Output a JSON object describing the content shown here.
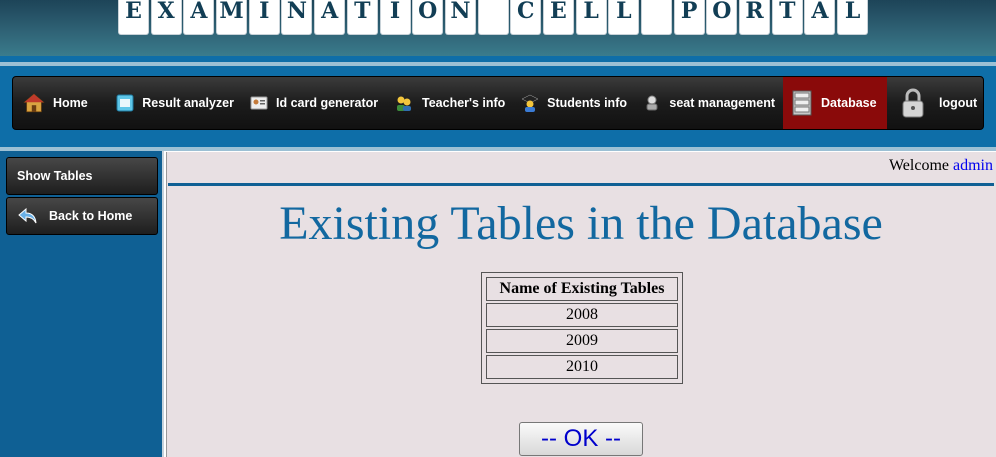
{
  "header": {
    "title_letters": [
      "E",
      "X",
      "A",
      "M",
      "I",
      "N",
      "A",
      "T",
      "I",
      "O",
      "N",
      " ",
      "C",
      "E",
      "L",
      "L",
      " ",
      "P",
      "O",
      "R",
      "T",
      "A",
      "L"
    ]
  },
  "nav": {
    "items": [
      {
        "label": "Home",
        "icon": "house-icon"
      },
      {
        "label": "Result analyzer",
        "icon": "chart-icon"
      },
      {
        "label": "Id card generator",
        "icon": "id-card-icon"
      },
      {
        "label": "Teacher's info",
        "icon": "group-icon"
      },
      {
        "label": "Students info",
        "icon": "student-icon"
      },
      {
        "label": "seat management",
        "icon": "seat-icon"
      },
      {
        "label": "Database",
        "icon": "database-icon",
        "active": true
      },
      {
        "label": "logout",
        "icon": "padlock-icon"
      }
    ],
    "active_color": "#8a0a0a"
  },
  "sidebar": {
    "items": [
      {
        "label": "Show Tables"
      },
      {
        "label": "Back to Home",
        "icon": "back-arrow-icon"
      }
    ]
  },
  "main": {
    "welcome_prefix": "Welcome",
    "username": "admin",
    "heading": "Existing Tables in the Database",
    "table": {
      "header": "Name of Existing Tables",
      "rows": [
        "2008",
        "2009",
        "2010"
      ]
    },
    "ok_label": "-- OK --"
  },
  "colors": {
    "brand_blue": "#0e6ea8",
    "heading": "#1268a0",
    "content_bg": "#e8e0e3"
  }
}
